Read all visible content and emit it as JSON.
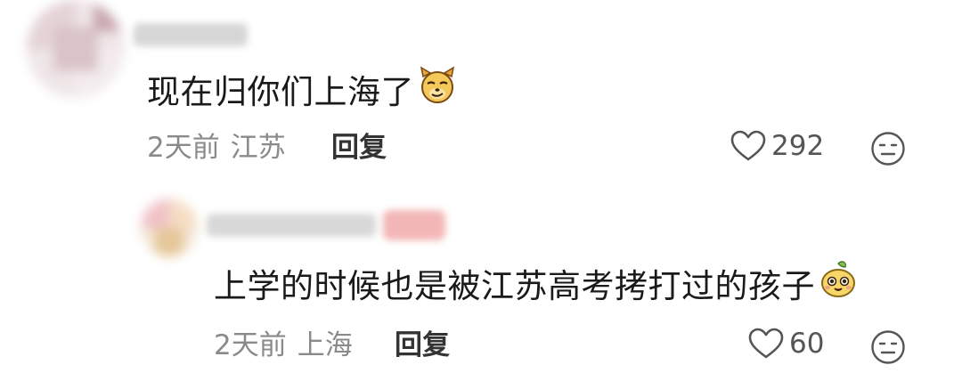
{
  "comments": [
    {
      "text": "现在归你们上海了",
      "time": "2天前",
      "location": "江苏",
      "reply_label": "回复",
      "like_count": "292",
      "emoji": "smirking-dog-emoji"
    },
    {
      "text": "上学的时候也是被江苏高考拷打过的孩子",
      "time": "2天前",
      "location": "上海",
      "reply_label": "回复",
      "like_count": "60",
      "emoji": "cute-pear-face-emoji"
    }
  ],
  "colors": {
    "text": "#1a1a1a",
    "meta": "#8a8a8a",
    "reply": "#333333",
    "icon": "#555555",
    "emoji_yellow": "#f5c85a"
  }
}
